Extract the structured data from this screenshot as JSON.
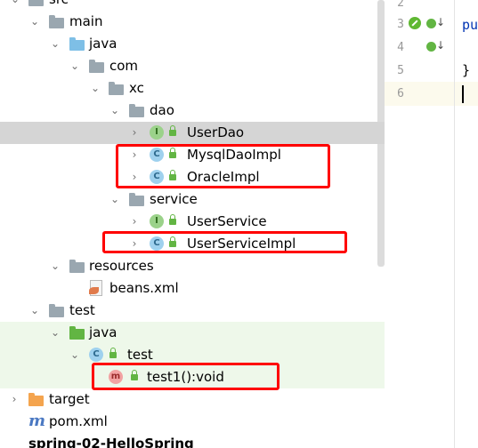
{
  "project_tree": {
    "items": [
      {
        "label": "src",
        "icon": "folder-gray-icon",
        "expanded": true
      },
      {
        "label": "main",
        "icon": "folder-gray-icon",
        "expanded": true
      },
      {
        "label": "java",
        "icon": "source-root-folder-icon",
        "expanded": true
      },
      {
        "label": "com",
        "icon": "package-icon",
        "expanded": true
      },
      {
        "label": "xc",
        "icon": "package-icon",
        "expanded": true
      },
      {
        "label": "dao",
        "icon": "package-icon",
        "expanded": true
      },
      {
        "label": "UserDao",
        "icon": "interface-icon",
        "badge": "I",
        "selected": true
      },
      {
        "label": "MysqlDaoImpl",
        "icon": "class-icon",
        "badge": "C"
      },
      {
        "label": "OracleImpl",
        "icon": "class-icon",
        "badge": "C"
      },
      {
        "label": "service",
        "icon": "package-icon",
        "expanded": true
      },
      {
        "label": "UserService",
        "icon": "interface-icon",
        "badge": "I"
      },
      {
        "label": "UserServiceImpl",
        "icon": "class-icon",
        "badge": "C"
      },
      {
        "label": "resources",
        "icon": "resources-folder-icon",
        "expanded": true
      },
      {
        "label": "beans.xml",
        "icon": "xml-file-icon"
      },
      {
        "label": "test",
        "icon": "folder-gray-icon",
        "expanded": true
      },
      {
        "label": "java",
        "icon": "test-root-folder-icon",
        "expanded": true
      },
      {
        "label": "test",
        "icon": "test-class-icon",
        "badge": "C",
        "expanded": true
      },
      {
        "label": "test1():void",
        "icon": "method-icon",
        "badge": "m"
      },
      {
        "label": "target",
        "icon": "folder-orange-icon",
        "expanded": false
      },
      {
        "label": "pom.xml",
        "icon": "maven-icon"
      },
      {
        "label": "spring-02-HelloSpring",
        "icon": "module-icon"
      }
    ]
  },
  "editor": {
    "line_numbers": [
      "2",
      "3",
      "4",
      "5",
      "6"
    ],
    "code_keyword": "pu",
    "code_brace": "}"
  },
  "colors": {
    "highlight_red": "#ff0000",
    "selection_gray": "#d5d5d5",
    "test_green_bg": "#eef8ea"
  }
}
